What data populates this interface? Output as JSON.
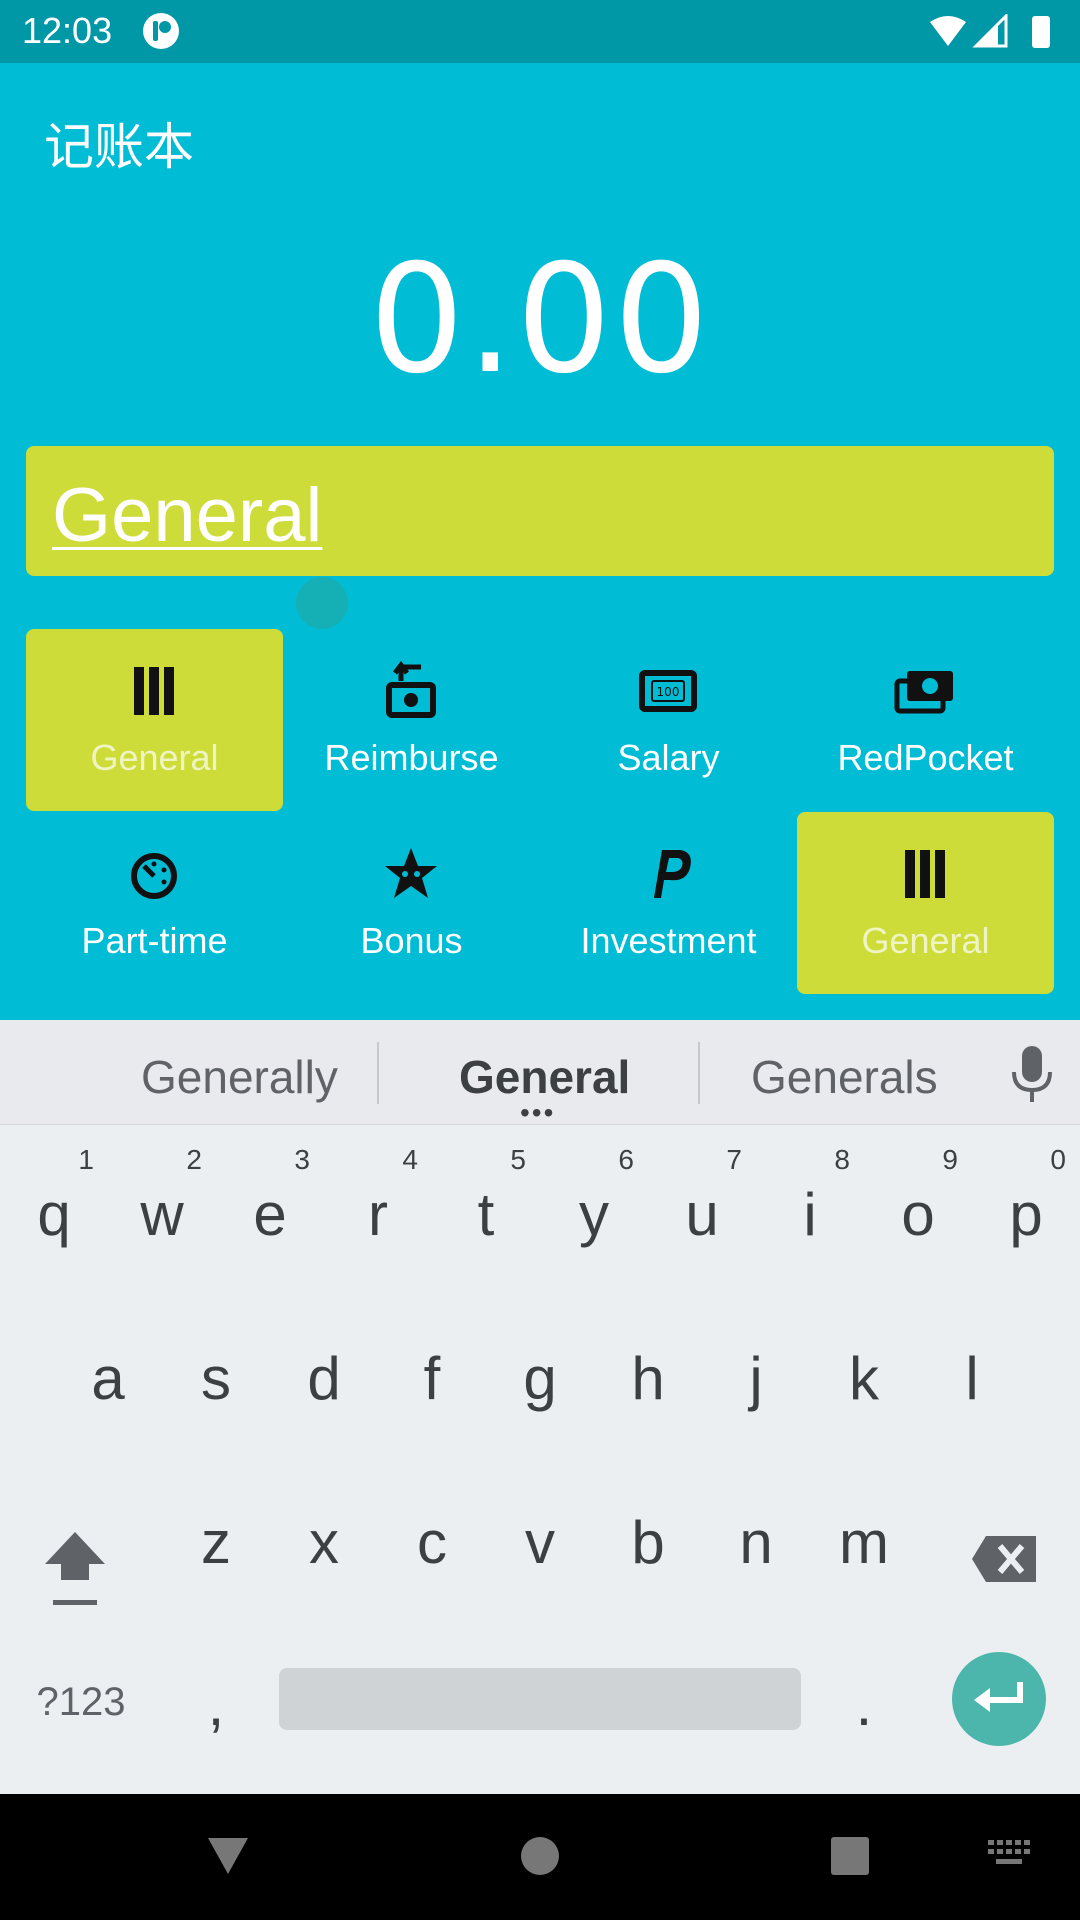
{
  "status": {
    "time": "12:03"
  },
  "app": {
    "title": "记账本",
    "amount": "0.00",
    "note_text": "General"
  },
  "categories": [
    {
      "label": "General",
      "icon": "bars-icon",
      "selected": true
    },
    {
      "label": "Reimburse",
      "icon": "reimburse-icon",
      "selected": false
    },
    {
      "label": "Salary",
      "icon": "banknote-icon",
      "selected": false
    },
    {
      "label": "RedPocket",
      "icon": "money-stack-icon",
      "selected": false
    },
    {
      "label": "Part-time",
      "icon": "clock-icon",
      "selected": false
    },
    {
      "label": "Bonus",
      "icon": "star-icon",
      "selected": false
    },
    {
      "label": "Investment",
      "icon": "paypal-icon",
      "selected": false
    },
    {
      "label": "General",
      "icon": "bars-icon",
      "selected": true
    }
  ],
  "keyboard": {
    "suggestions": [
      "Generally",
      "General",
      "Generals"
    ],
    "row1": [
      {
        "ch": "q",
        "num": "1"
      },
      {
        "ch": "w",
        "num": "2"
      },
      {
        "ch": "e",
        "num": "3"
      },
      {
        "ch": "r",
        "num": "4"
      },
      {
        "ch": "t",
        "num": "5"
      },
      {
        "ch": "y",
        "num": "6"
      },
      {
        "ch": "u",
        "num": "7"
      },
      {
        "ch": "i",
        "num": "8"
      },
      {
        "ch": "o",
        "num": "9"
      },
      {
        "ch": "p",
        "num": "0"
      }
    ],
    "row2": [
      "a",
      "s",
      "d",
      "f",
      "g",
      "h",
      "j",
      "k",
      "l"
    ],
    "row3": [
      "z",
      "x",
      "c",
      "v",
      "b",
      "n",
      "m"
    ],
    "symbols_label": "?123",
    "comma": ",",
    "period": "."
  },
  "colors": {
    "primary": "#00bcd4",
    "accent": "#cddc39",
    "status_bar": "#0097a7",
    "enter": "#4db6ac"
  }
}
